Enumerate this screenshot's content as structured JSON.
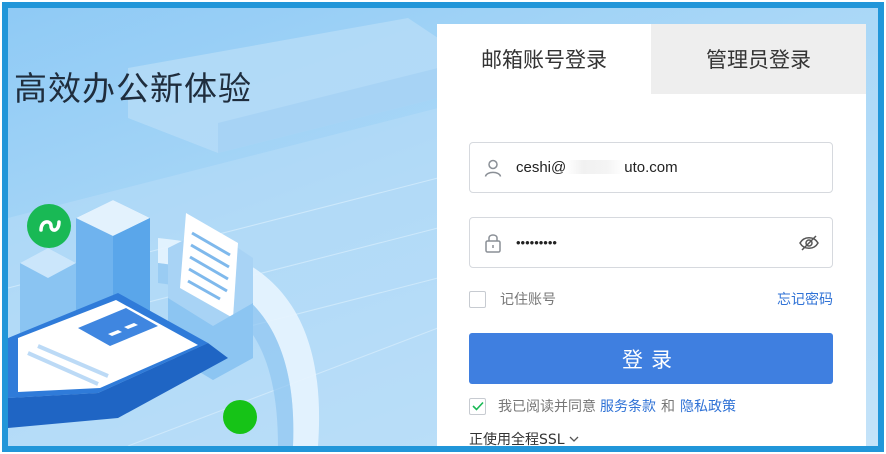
{
  "hero": {
    "title": "高效办公新体验"
  },
  "tabs": [
    {
      "label": "邮箱账号登录",
      "active": true
    },
    {
      "label": "管理员登录",
      "active": false
    }
  ],
  "form": {
    "username": {
      "prefix": "ceshi@",
      "suffix": "uto.com",
      "icon": "user-icon"
    },
    "password": {
      "masked": "•••••••••",
      "icon": "lock-icon",
      "toggle_icon": "eye-off-icon"
    },
    "remember_label": "记住账号",
    "remember_checked": false,
    "forgot_label": "忘记密码",
    "login_label": "登录",
    "agree": {
      "checked": true,
      "prefix": "我已阅读并同意",
      "terms": "服务条款",
      "and": "和",
      "privacy": "隐私政策"
    },
    "ssl_label": "正使用全程SSL"
  },
  "colors": {
    "frame_border": "#2196d9",
    "primary": "#3f7fe0",
    "link": "#2f72d6",
    "mini_program_green": "#19b955",
    "dot_green": "#16c317"
  }
}
